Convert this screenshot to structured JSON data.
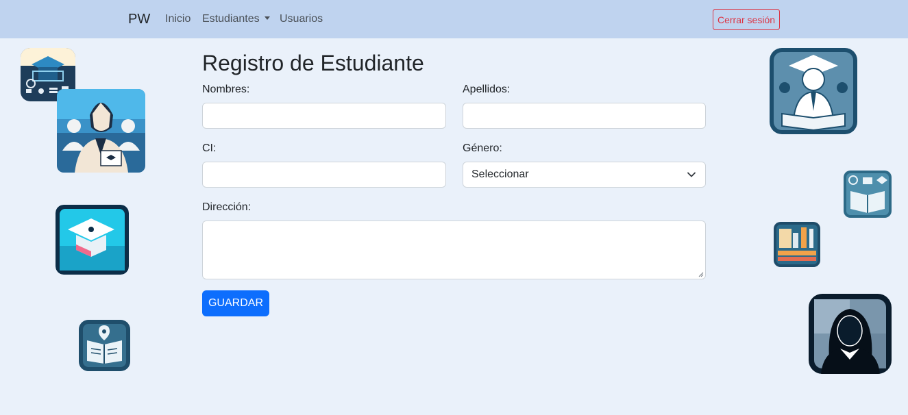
{
  "navbar": {
    "brand": "PW",
    "links": [
      {
        "label": "Inicio"
      },
      {
        "label": "Estudiantes",
        "has_dropdown": true
      },
      {
        "label": "Usuarios"
      }
    ],
    "logout_label": "Cerrar sesión"
  },
  "form": {
    "title": "Registro de Estudiante",
    "fields": {
      "nombres": {
        "label": "Nombres:",
        "value": ""
      },
      "apellidos": {
        "label": "Apellidos:",
        "value": ""
      },
      "ci": {
        "label": "CI:",
        "value": ""
      },
      "genero": {
        "label": "Género:",
        "selected": "Seleccionar"
      },
      "direccion": {
        "label": "Dirección:",
        "value": ""
      }
    },
    "submit_label": "GUARDAR"
  },
  "decorations": [
    {
      "icon": "graduation-cap-laptop-icon"
    },
    {
      "icon": "student-group-icon"
    },
    {
      "icon": "graduation-cap-screen-icon"
    },
    {
      "icon": "book-location-icon"
    },
    {
      "icon": "graduate-reading-icon"
    },
    {
      "icon": "book-education-icon"
    },
    {
      "icon": "books-pencils-icon"
    },
    {
      "icon": "female-avatar-icon"
    }
  ],
  "colors": {
    "navbar_bg": "#bfd3ef",
    "page_bg": "#eaf1fa",
    "primary": "#0d6efd",
    "danger": "#dc3545"
  }
}
